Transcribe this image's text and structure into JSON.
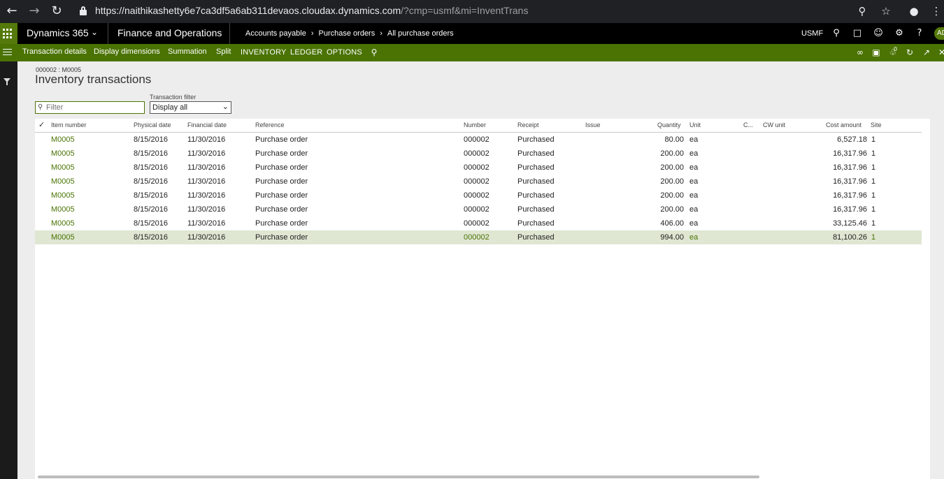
{
  "browser": {
    "url_main": "https://naithikashetty6e7ca3df5a6ab311devaos.cloudax.dynamics.com",
    "url_query": "/?cmp=usmf&mi=InventTrans"
  },
  "appbar": {
    "brand": "Dynamics 365",
    "product": "Finance and Operations",
    "breadcrumb": [
      "Accounts payable",
      "Purchase orders",
      "All purchase orders"
    ],
    "company": "USMF",
    "avatar": "AD"
  },
  "actionpane": {
    "buttons": [
      "Transaction details",
      "Display dimensions",
      "Summation",
      "Split"
    ],
    "tabs": [
      "INVENTORY",
      "LEDGER",
      "OPTIONS"
    ],
    "notification_count": "0"
  },
  "page": {
    "caption": "000002 : M0005",
    "title": "Inventory transactions",
    "filter_placeholder": "Filter",
    "transaction_filter_label": "Transaction filter",
    "transaction_filter_value": "Display all"
  },
  "grid": {
    "headers": {
      "item_number": "Item number",
      "physical_date": "Physical date",
      "financial_date": "Financial date",
      "reference": "Reference",
      "number": "Number",
      "receipt": "Receipt",
      "issue": "Issue",
      "quantity": "Quantity",
      "unit": "Unit",
      "c": "C...",
      "cw_unit": "CW unit",
      "cost_amount": "Cost amount",
      "site": "Site"
    },
    "rows": [
      {
        "item": "M0005",
        "physical_date": "8/15/2016",
        "financial_date": "11/30/2016",
        "reference": "Purchase order",
        "number": "000002",
        "receipt": "Purchased",
        "quantity": "80.00",
        "unit": "ea",
        "cost_amount": "6,527.18",
        "site": "1"
      },
      {
        "item": "M0005",
        "physical_date": "8/15/2016",
        "financial_date": "11/30/2016",
        "reference": "Purchase order",
        "number": "000002",
        "receipt": "Purchased",
        "quantity": "200.00",
        "unit": "ea",
        "cost_amount": "16,317.96",
        "site": "1"
      },
      {
        "item": "M0005",
        "physical_date": "8/15/2016",
        "financial_date": "11/30/2016",
        "reference": "Purchase order",
        "number": "000002",
        "receipt": "Purchased",
        "quantity": "200.00",
        "unit": "ea",
        "cost_amount": "16,317.96",
        "site": "1"
      },
      {
        "item": "M0005",
        "physical_date": "8/15/2016",
        "financial_date": "11/30/2016",
        "reference": "Purchase order",
        "number": "000002",
        "receipt": "Purchased",
        "quantity": "200.00",
        "unit": "ea",
        "cost_amount": "16,317.96",
        "site": "1"
      },
      {
        "item": "M0005",
        "physical_date": "8/15/2016",
        "financial_date": "11/30/2016",
        "reference": "Purchase order",
        "number": "000002",
        "receipt": "Purchased",
        "quantity": "200.00",
        "unit": "ea",
        "cost_amount": "16,317.96",
        "site": "1"
      },
      {
        "item": "M0005",
        "physical_date": "8/15/2016",
        "financial_date": "11/30/2016",
        "reference": "Purchase order",
        "number": "000002",
        "receipt": "Purchased",
        "quantity": "200.00",
        "unit": "ea",
        "cost_amount": "16,317.96",
        "site": "1"
      },
      {
        "item": "M0005",
        "physical_date": "8/15/2016",
        "financial_date": "11/30/2016",
        "reference": "Purchase order",
        "number": "000002",
        "receipt": "Purchased",
        "quantity": "406.00",
        "unit": "ea",
        "cost_amount": "33,125.46",
        "site": "1"
      },
      {
        "item": "M0005",
        "physical_date": "8/15/2016",
        "financial_date": "11/30/2016",
        "reference": "Purchase order",
        "number": "000002",
        "receipt": "Purchased",
        "quantity": "994.00",
        "unit": "ea",
        "cost_amount": "81,100.26",
        "site": "1",
        "selected": true
      }
    ]
  }
}
